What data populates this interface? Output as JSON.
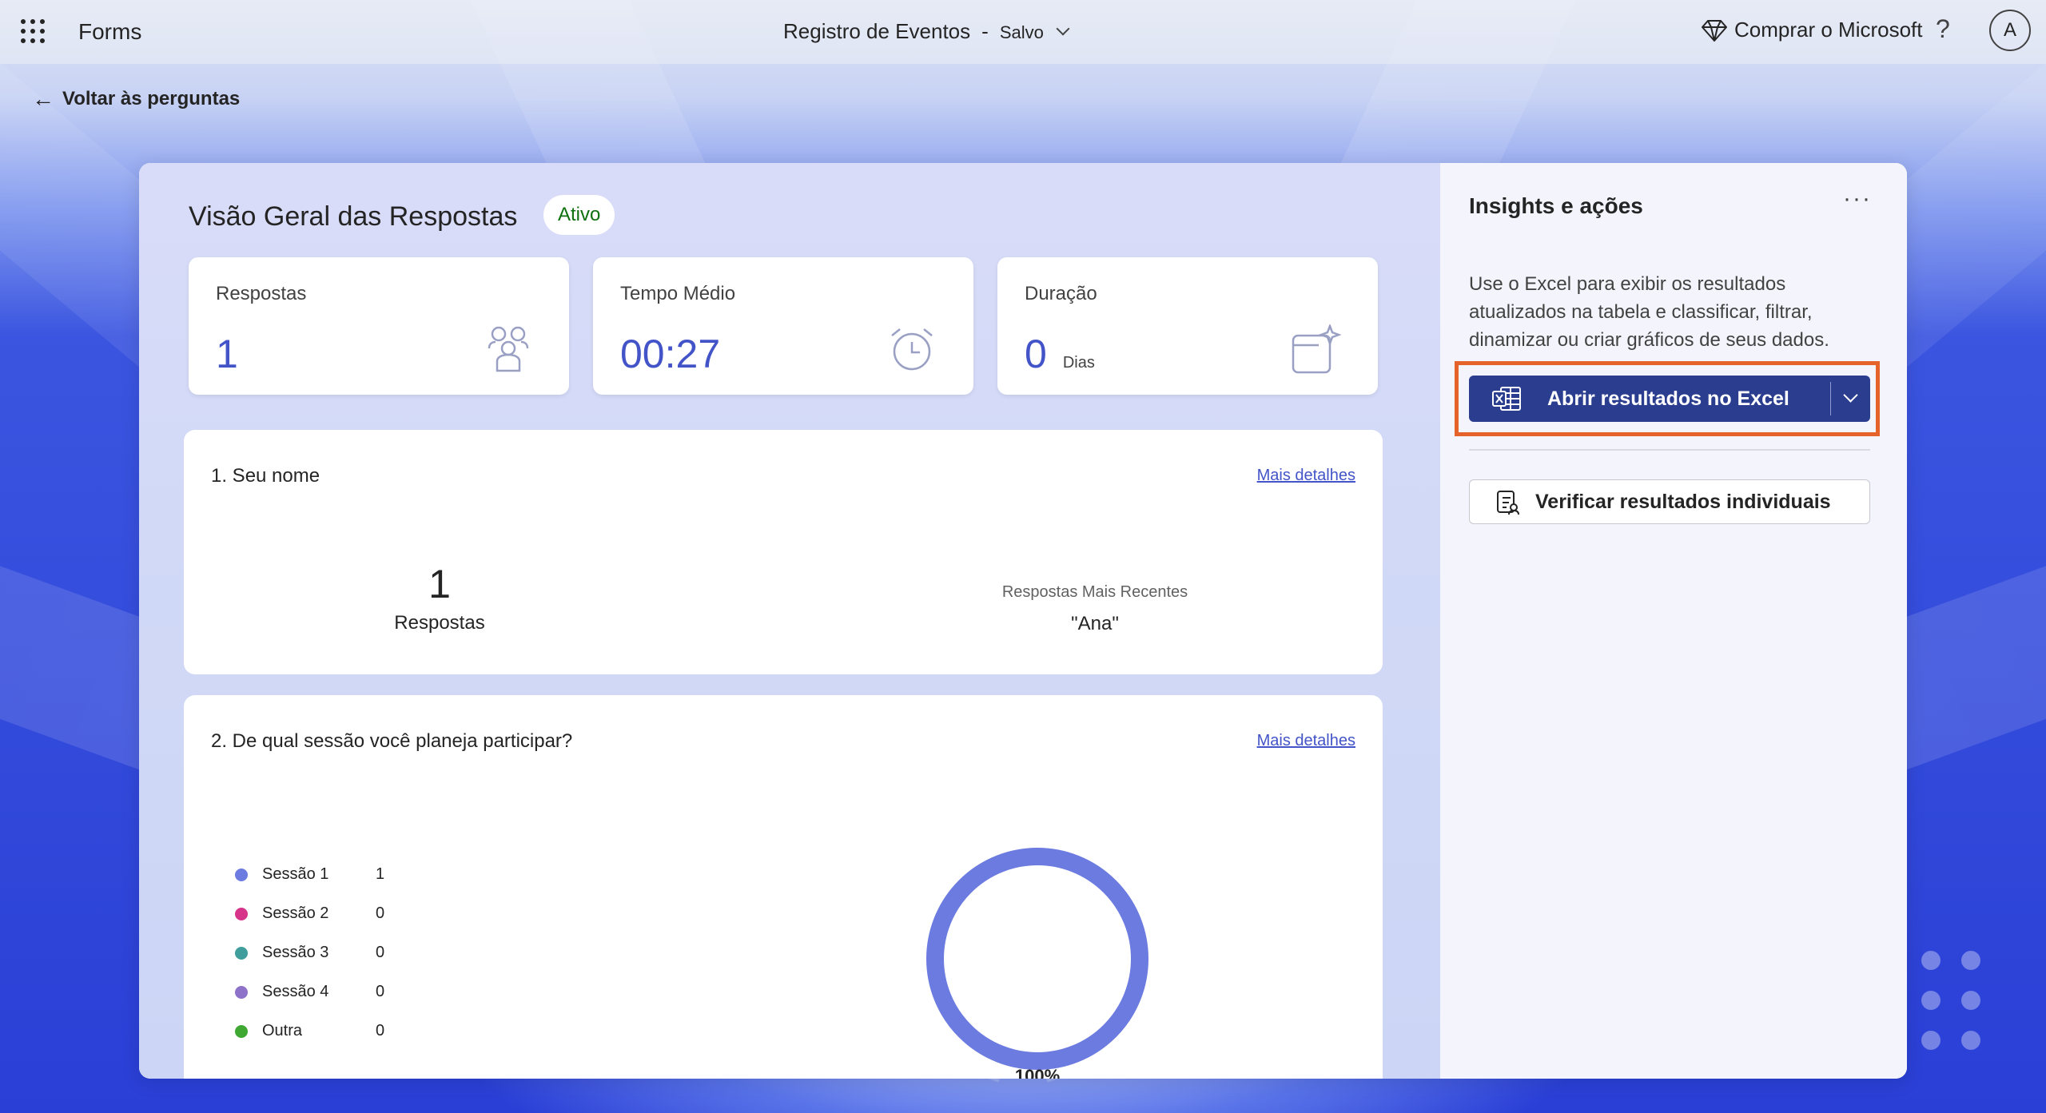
{
  "header": {
    "app_name": "Forms",
    "form_title": "Registro de Eventos",
    "separator": "-",
    "save_status": "Salvo",
    "buy_label": "Comprar o Microsoft",
    "help_label": "?",
    "avatar_initial": "A"
  },
  "nav": {
    "back_label": "Voltar às perguntas"
  },
  "overview": {
    "title": "Visão Geral das Respostas",
    "status_badge": "Ativo",
    "stats": [
      {
        "label": "Respostas",
        "value": "1",
        "unit": "",
        "icon": "people-icon"
      },
      {
        "label": "Tempo Médio",
        "value": "00:27",
        "unit": "",
        "icon": "alarm-clock-icon"
      },
      {
        "label": "Duração",
        "value": "0",
        "unit": "Dias",
        "icon": "calendar-sparkle-icon"
      }
    ]
  },
  "questions": [
    {
      "title": "1. Seu nome",
      "more_details": "Mais detalhes",
      "response_count": "1",
      "response_label": "Respostas",
      "recent_heading": "Respostas Mais Recentes",
      "recent_value": "\"Ana\""
    },
    {
      "title": "2. De qual sessão você planeja participar?",
      "more_details": "Mais detalhes",
      "percent_label": "100%"
    }
  ],
  "chart_data": {
    "type": "pie",
    "categories": [
      "Sessão 1",
      "Sessão 2",
      "Sessão 3",
      "Sessão 4",
      "Outra"
    ],
    "values": [
      1,
      0,
      0,
      0,
      0
    ],
    "colors": [
      "#6b7be0",
      "#d6338a",
      "#3f9e9b",
      "#8e72c9",
      "#3ea832"
    ],
    "legend_position": "left",
    "data_labels": [
      "100%"
    ]
  },
  "insights": {
    "title": "Insights e ações",
    "more_options": "···",
    "description": "Use o Excel para exibir os resultados atualizados na tabela e classificar, filtrar, dinamizar ou criar gráficos de seus dados.",
    "excel_button": "Abrir resultados no Excel",
    "individual_button": "Verificar resultados individuais",
    "highlight_color": "#e5622a",
    "primary_color": "#2a3d8f"
  }
}
